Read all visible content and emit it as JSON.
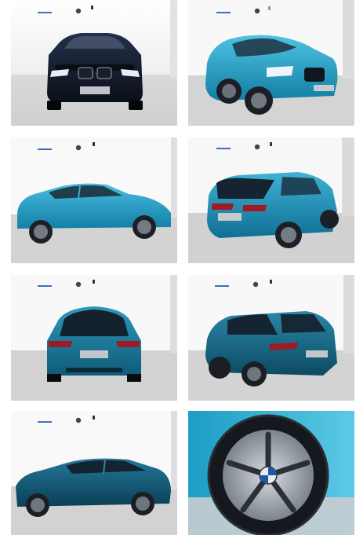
{
  "gallery": {
    "photos": [
      {
        "view": "front",
        "icon": "car-front-photo",
        "color": "#0f1726"
      },
      {
        "view": "front-three-quarter",
        "icon": "car-front-quarter-photo",
        "color": "#1fa1c6"
      },
      {
        "view": "side",
        "icon": "car-side-photo",
        "color": "#1e9cc4"
      },
      {
        "view": "rear-three-quarter",
        "icon": "car-rear-quarter-photo",
        "color": "#1f93b8"
      },
      {
        "view": "rear",
        "icon": "car-rear-photo",
        "color": "#1e7f9e"
      },
      {
        "view": "rear-left-quarter",
        "icon": "car-rear-left-photo",
        "color": "#1b6a86"
      },
      {
        "view": "side-left",
        "icon": "car-side-left-photo",
        "color": "#175a73"
      },
      {
        "view": "wheel",
        "icon": "wheel-detail-photo",
        "color": "#2a2f35"
      }
    ]
  }
}
